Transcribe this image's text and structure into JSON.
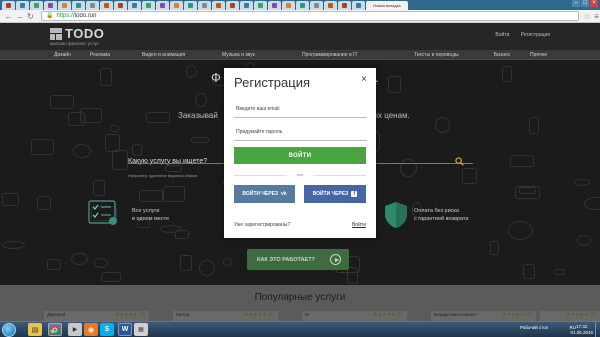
{
  "browser": {
    "active_tab_title": "Новая вкладка",
    "url_scheme": "https://",
    "url_host": "todo.run",
    "tab_count": 26
  },
  "site": {
    "logo": "TODO",
    "tagline": "магазин фриланс услуг",
    "header_links": [
      "Войти",
      "Регистрация"
    ],
    "categories": [
      "Дизайн",
      "Реклама",
      "Видео и анимация",
      "Музыка и звук",
      "Программирование и IT",
      "Тексты и переводы",
      "Бизнес",
      "Прочее"
    ]
  },
  "hero": {
    "title_left": "Ф",
    "title_right": "в.",
    "subtitle_left": "Заказывай",
    "subtitle_right": "вых ценам.",
    "search_placeholder": "Какую услугу вы ищете?",
    "search_example": "Например: удаление водяных знаков",
    "feature_left": [
      "Все услуги",
      "в одном месте"
    ],
    "feature_right": [
      "Оплата без риска",
      "с гарантией возврата"
    ],
    "how_button": "КАК ЭТО РАБОТАЕТ?"
  },
  "popular": {
    "title": "Популярные услуги",
    "providers": [
      {
        "name": "Дмитрий",
        "rating": "(3)"
      },
      {
        "name": "Митер",
        "rating": "(1)"
      },
      {
        "name": "IS",
        "rating": "(1)"
      },
      {
        "name": "Владислав Колинен",
        "rating": "(1)"
      },
      {
        "name": "",
        "rating": "(2)"
      }
    ],
    "stars": "★★★★★"
  },
  "modal": {
    "title": "Регистрация",
    "close": "×",
    "email_placeholder": "Введите ваш email",
    "password_placeholder": "Придумайте пароль",
    "submit": "ВОЙТИ",
    "or": "или",
    "vk_button": "ВОЙТИ ЧЕРЕЗ",
    "vk_icon": "vk",
    "fb_button": "ВОЙТИ ЧЕРЕЗ",
    "fb_icon": "f",
    "already": "Уже зарегистрированы?",
    "login_link": "Войти"
  },
  "taskbar": {
    "tray_text": "Рабочий стол",
    "lang": "RU",
    "time": "17:42",
    "date": "01.06.2016"
  },
  "colors": {
    "green": "#4aa541",
    "vk": "#557ba1",
    "fb": "#4866a2"
  }
}
